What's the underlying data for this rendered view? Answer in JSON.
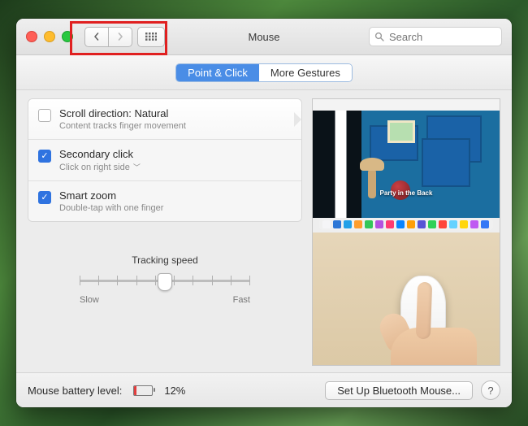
{
  "window": {
    "title": "Mouse"
  },
  "search": {
    "placeholder": "Search"
  },
  "tabs": {
    "point": "Point & Click",
    "gestures": "More Gestures",
    "active": "point"
  },
  "options": {
    "scroll": {
      "title": "Scroll direction: Natural",
      "sub": "Content tracks finger movement",
      "checked": false
    },
    "secondary": {
      "title": "Secondary click",
      "sub": "Click on right side",
      "checked": true
    },
    "smartzoom": {
      "title": "Smart zoom",
      "sub": "Double-tap with one finger",
      "checked": true
    }
  },
  "tracking": {
    "label": "Tracking speed",
    "slow": "Slow",
    "fast": "Fast",
    "position_percent": 50
  },
  "preview": {
    "caption_title": "Party in the Back",
    "caption_sub": "                                        "
  },
  "footer": {
    "battery_label": "Mouse battery level:",
    "battery_percent": "12%",
    "setup_btn": "Set Up Bluetooth Mouse...",
    "help": "?"
  }
}
